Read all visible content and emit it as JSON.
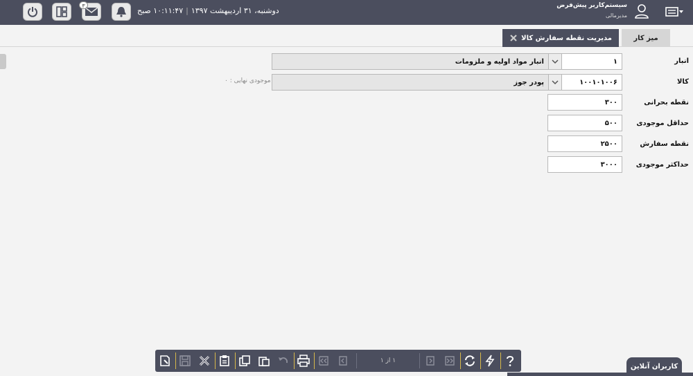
{
  "header": {
    "datetime": "دوشنبه، ۳۱ اردیبهشت ۱۳۹۷",
    "time": "۱۰:۱۱:۴۷ صبح",
    "message_count": "۳",
    "user_title": "سیستم‌کاربر پیش‌فرض",
    "user_role": "مدیرمالی",
    "icons": [
      "power-icon",
      "apps-icon",
      "mail-icon",
      "bell-icon",
      "user-icon",
      "menu-icon"
    ]
  },
  "tabs": {
    "desk": "میز کار",
    "active": "مدیریت نقطه سفارش کالا"
  },
  "form": {
    "warehouse": {
      "label": "انبار",
      "code": "۱",
      "name": "انبار مواد اولیه و ملزومات"
    },
    "item": {
      "label": "کالا",
      "code": "۱۰۰۱۰۱۰۰۶",
      "name": "پودر جوز",
      "note": "موجودی نهایی : ۰"
    },
    "critical_point": {
      "label": "نقطه بحرانی",
      "value": "۳۰۰"
    },
    "min_stock": {
      "label": "حداقل موجودی",
      "value": "۵۰۰"
    },
    "order_point": {
      "label": "نقطه سفارش",
      "value": "۲۵۰۰"
    },
    "max_stock": {
      "label": "حداکثر موجودی",
      "value": "۳۰۰۰"
    }
  },
  "toolbar": {
    "pager": "۱ از ۱"
  },
  "online_users": "کاربران آنلاین"
}
